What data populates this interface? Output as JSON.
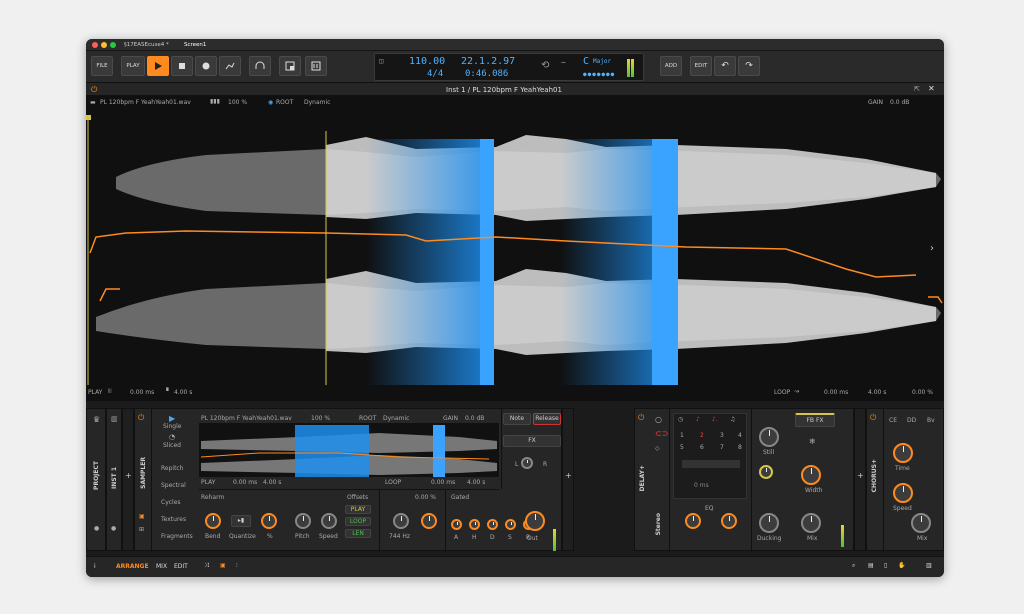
{
  "window": {
    "tabs": [
      "§17EASEcuse4 *",
      "Screen1"
    ],
    "colors": {
      "accent": "#ff8a1f",
      "blue": "#2f9bf0",
      "yellow": "#d8c64a"
    }
  },
  "toolbar": {
    "file": "FILE",
    "play": "PLAY",
    "add": "ADD",
    "edit": "EDIT",
    "tempo": "110.00",
    "time_sig": "4/4",
    "position": "22.1.2.97",
    "time": "0:46.086",
    "key_letter": "C",
    "key_mode": "Major"
  },
  "editor": {
    "title": "Inst 1 / PL 120bpm F YeahYeah01",
    "file": "PL 120bpm F YeahYeah01.wav",
    "zoom": "100 %",
    "root": "ROOT",
    "mode": "Dynamic",
    "gain_label": "GAIN",
    "gain_value": "0.0 dB",
    "play": "PLAY",
    "play_start": "0.00 ms",
    "play_len": "4.00 s",
    "loop": "LOOP",
    "loop_start": "0.00 ms",
    "loop_len": "4.00 s",
    "loop_pct": "0.00 %"
  },
  "devices": {
    "project": "PROJECT",
    "inst": "INST 1",
    "sampler": "SAMPLER",
    "modes": {
      "single": "Single",
      "sliced": "Sliced"
    },
    "sampler_items": [
      "Repitch",
      "Spectral",
      "Cycles",
      "Textures",
      "Fragments"
    ],
    "mini_file": "PL 120bpm F YeahYeah01.wav",
    "mini_zoom": "100 %",
    "mini_root": "ROOT",
    "mini_mode": "Dynamic",
    "mini_gain": "GAIN",
    "mini_gain_val": "0.0 dB",
    "mini_play": "PLAY",
    "mini_play_start": "0.00 ms",
    "mini_play_len": "4.00 s",
    "mini_loop": "LOOP",
    "mini_loop_start": "0.00 ms",
    "mini_loop_len": "4.00 s",
    "reharm": "Reharm",
    "bend": "Bend",
    "quantize": "Quantize",
    "pct": "%",
    "pitch": "Pitch",
    "speed": "Speed",
    "offsets": "Offsets",
    "off_play": "PLAY",
    "off_loop": "LOOP",
    "off_len": "LEN",
    "filter_pct": "0.00 %",
    "filter_hz": "744 Hz",
    "gated": "Gated",
    "adsr": [
      "A",
      "H",
      "D",
      "S",
      "R"
    ],
    "note": "Note",
    "release": "Release",
    "fx": "FX",
    "out": "Out",
    "l": "L",
    "r": "R",
    "delay": "DELAY+",
    "stereo": "Stereo",
    "pad_numbers": [
      "1",
      "2",
      "3",
      "4",
      "5",
      "6",
      "7",
      "8"
    ],
    "pad_ms": "0 ms",
    "eq": "EQ",
    "still": "Still",
    "width": "Width",
    "ducking": "Ducking",
    "mix": "Mix",
    "fbfx": "FB FX",
    "chorus": "CHORUS+",
    "chorus_tabs": [
      "CE",
      "DD",
      "Bv"
    ],
    "time": "Time",
    "speed2": "Speed",
    "mix2": "Mix"
  },
  "bottom": {
    "arrange": "ARRANGE",
    "mix": "MIX",
    "edit": "EDIT"
  }
}
